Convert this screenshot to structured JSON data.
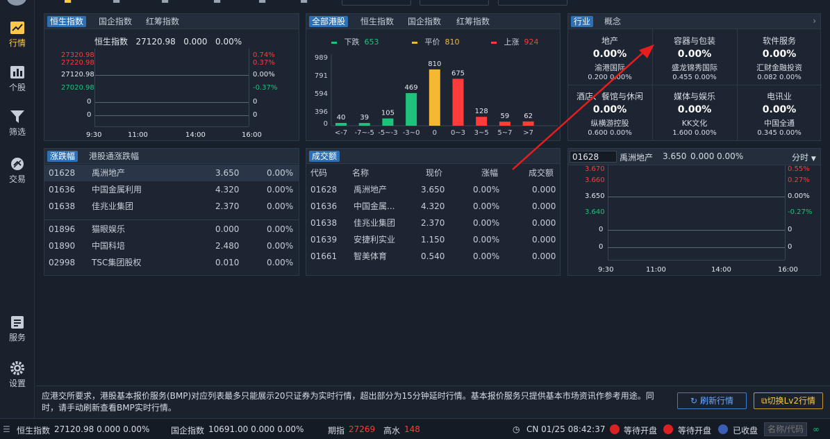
{
  "sidebar": {
    "items": [
      {
        "label": "行情",
        "icon": "chart-line-icon",
        "active": true
      },
      {
        "label": "个股",
        "icon": "bar-chart-icon"
      },
      {
        "label": "筛选",
        "icon": "filter-icon"
      },
      {
        "label": "交易",
        "icon": "trade-icon"
      },
      {
        "label": "服务",
        "icon": "document-icon"
      },
      {
        "label": "设置",
        "icon": "gear-icon"
      }
    ]
  },
  "hsi_panel": {
    "tabs": [
      "恒生指数",
      "国企指数",
      "红筹指数"
    ],
    "header": {
      "name": "恒生指数",
      "price": "27120.98",
      "change": "0.000",
      "pct": "0.00%"
    },
    "left_labels": [
      "27320.98",
      "27220.98",
      "27120.98",
      "27020.98",
      "0",
      "0"
    ],
    "right_labels": [
      "0.74%",
      "0.37%",
      "0.00%",
      "-0.37%",
      "0",
      "0"
    ],
    "x_labels": [
      "9:30",
      "11:00",
      "14:00",
      "16:00"
    ]
  },
  "dist_panel": {
    "tabs": [
      "全部港股",
      "恒生指数",
      "国企指数",
      "红筹指数"
    ],
    "legend": [
      {
        "label": "下跌",
        "count": "653",
        "color": "#1ec27a"
      },
      {
        "label": "平价",
        "count": "810",
        "color": "#f5b833"
      },
      {
        "label": "上涨",
        "count": "924",
        "color": "#ff3b3b"
      }
    ],
    "y_labels": [
      "989",
      "791",
      "594",
      "396",
      "0"
    ]
  },
  "chart_data": {
    "type": "bar",
    "categories": [
      "<-7",
      "-7~-5",
      "-5~-3",
      "-3~0",
      "0",
      "0~3",
      "3~5",
      "5~7",
      ">7"
    ],
    "values": [
      40,
      39,
      105,
      469,
      810,
      675,
      128,
      59,
      62
    ],
    "colors": [
      "#1ec27a",
      "#1ec27a",
      "#1ec27a",
      "#1ec27a",
      "#f5b833",
      "#ff3b3b",
      "#ff3b3b",
      "#ff3b3b",
      "#ff3b3b"
    ],
    "y_ticks": [
      "989",
      "791",
      "594",
      "396",
      "0"
    ],
    "ylim": [
      0,
      989
    ]
  },
  "industry_panel": {
    "tabs": [
      "行业",
      "概念"
    ],
    "cells": [
      {
        "name": "地产",
        "pct": "0.00%",
        "stock": "渝港国际",
        "detail": "0.200 0.00%"
      },
      {
        "name": "容器与包装",
        "pct": "0.00%",
        "stock": "盛龙锦秀国际",
        "detail": "0.455 0.00%"
      },
      {
        "name": "软件服务",
        "pct": "0.00%",
        "stock": "汇财金融投资",
        "detail": "0.082 0.00%"
      },
      {
        "name": "酒店、餐馆与休闲",
        "pct": "0.00%",
        "stock": "纵横游控股",
        "detail": "0.600 0.00%"
      },
      {
        "name": "媒体与娱乐",
        "pct": "0.00%",
        "stock": "KK文化",
        "detail": "1.600 0.00%"
      },
      {
        "name": "电讯业",
        "pct": "0.00%",
        "stock": "中国全通",
        "detail": "0.345 0.00%"
      }
    ]
  },
  "gainers_panel": {
    "tabs": [
      "涨跌幅",
      "港股通涨跌幅"
    ],
    "rows_top": [
      {
        "code": "01628",
        "name": "禹洲地产",
        "price": "3.650",
        "pct": "0.00%"
      },
      {
        "code": "01636",
        "name": "中国金属利用",
        "price": "4.320",
        "pct": "0.00%"
      },
      {
        "code": "01638",
        "name": "佳兆业集团",
        "price": "2.370",
        "pct": "0.00%"
      }
    ],
    "rows_bottom": [
      {
        "code": "01896",
        "name": "猫眼娱乐",
        "price": "0.000",
        "pct": "0.00%"
      },
      {
        "code": "01890",
        "name": "中国科培",
        "price": "2.480",
        "pct": "0.00%"
      },
      {
        "code": "02998",
        "name": "TSC集团股权",
        "price": "0.010",
        "pct": "0.00%"
      }
    ]
  },
  "turnover_panel": {
    "tabs": [
      "成交额"
    ],
    "headers": [
      "代码",
      "名称",
      "现价",
      "涨幅",
      "成交额"
    ],
    "rows": [
      {
        "code": "01628",
        "name": "禹洲地产",
        "price": "3.650",
        "pct": "0.00%",
        "amt": "0.000"
      },
      {
        "code": "01636",
        "name": "中国金属...",
        "price": "4.320",
        "pct": "0.00%",
        "amt": "0.000"
      },
      {
        "code": "01638",
        "name": "佳兆业集团",
        "price": "2.370",
        "pct": "0.00%",
        "amt": "0.000"
      },
      {
        "code": "01639",
        "name": "安捷利实业",
        "price": "1.150",
        "pct": "0.00%",
        "amt": "0.000"
      },
      {
        "code": "01661",
        "name": "智美体育",
        "price": "0.540",
        "pct": "0.00%",
        "amt": "0.000"
      }
    ]
  },
  "stock_panel": {
    "code_input": "01628",
    "name": "禹洲地产",
    "price": "3.650",
    "change": "0.000",
    "pct": "0.00%",
    "mode": "分时",
    "left_labels": [
      "3.670",
      "3.660",
      "3.650",
      "3.640",
      "0",
      "0"
    ],
    "right_labels": [
      "0.55%",
      "0.27%",
      "0.00%",
      "-0.27%",
      "0",
      "0"
    ],
    "x_labels": [
      "9:30",
      "11:00",
      "14:00",
      "16:00"
    ]
  },
  "notice": {
    "text": "应港交所要求，港股基本报价服务(BMP)对应列表最多只能展示20只证券为实时行情，超出部分为15分钟延时行情。基本报价服务只提供基本市场资讯作参考用途。同时，请手动刷新查看BMP实时行情。",
    "refresh_label": "刷新行情",
    "switch_label": "切换Lv2行情"
  },
  "statusbar": {
    "hsi_label": "恒生指数",
    "hsi_value": "27120.98 0.000 0.00%",
    "hscei_label": "国企指数",
    "hscei_value": "10691.00 0.000 0.00%",
    "futures_label": "期指",
    "futures_value": "27269",
    "premium_label": "高水",
    "premium_value": "148",
    "clock": "CN 01/25 08:42:37",
    "hk_status": "等待开盘",
    "cn_status": "等待开盘",
    "us_status": "已收盘",
    "search_placeholder": "名称/代码"
  }
}
